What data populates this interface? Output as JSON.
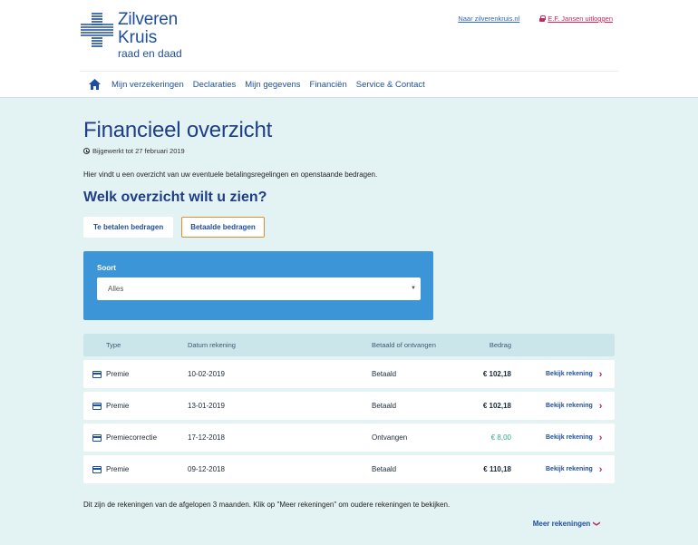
{
  "brand": {
    "line1": "Zilveren",
    "line2": "Kruis",
    "tagline": "raad en daad",
    "color": "#1e4e9c"
  },
  "toplinks": {
    "site": "Naar zilverenkruis.nl",
    "logout": "E.F. Jansen uitloggen"
  },
  "nav": {
    "home_icon": "home-icon",
    "items": [
      "Mijn verzekeringen",
      "Declaraties",
      "Mijn gegevens",
      "Financiën",
      "Service & Contact"
    ]
  },
  "page": {
    "title": "Financieel overzicht",
    "updated": "Bijgewerkt tot 27 februari 2019",
    "intro": "Hier vindt u een overzicht van uw eventuele betalingsregelingen en openstaande bedragen.",
    "question": "Welk overzicht wilt u zien?"
  },
  "tabs": [
    {
      "label": "Te betalen bedragen",
      "active": false
    },
    {
      "label": "Betaalde bedragen",
      "active": true
    }
  ],
  "filter": {
    "label": "Soort",
    "selected": "Alles"
  },
  "table": {
    "headers": {
      "type": "Type",
      "date": "Datum rekening",
      "status": "Betaald of ontvangen",
      "amount": "Bedrag"
    },
    "rows": [
      {
        "type": "Premie",
        "date": "10-02-2019",
        "status": "Betaald",
        "amount": "€ 102,18",
        "link": "Bekijk rekening"
      },
      {
        "type": "Premie",
        "date": "13-01-2019",
        "status": "Betaald",
        "amount": "€ 102,18",
        "link": "Bekijk rekening"
      },
      {
        "type": "Premiecorrectie",
        "date": "17-12-2018",
        "status": "Ontvangen",
        "amount": "€ 8,00",
        "link": "Bekijk rekening"
      },
      {
        "type": "Premie",
        "date": "09-12-2018",
        "status": "Betaald",
        "amount": "€ 110,18",
        "link": "Bekijk rekening"
      }
    ]
  },
  "footnote": "Dit zijn de rekeningen van de afgelopen 3 maanden. Klik op \"Meer rekeningen\" om oudere rekeningen te bekijken.",
  "more_label": "Meer rekeningen",
  "colors": {
    "accent": "#e58a2e",
    "link": "#c4285a",
    "filter_bg": "#3b95d6",
    "page_bg": "#e3f2f3",
    "received": "#2faa8a"
  }
}
